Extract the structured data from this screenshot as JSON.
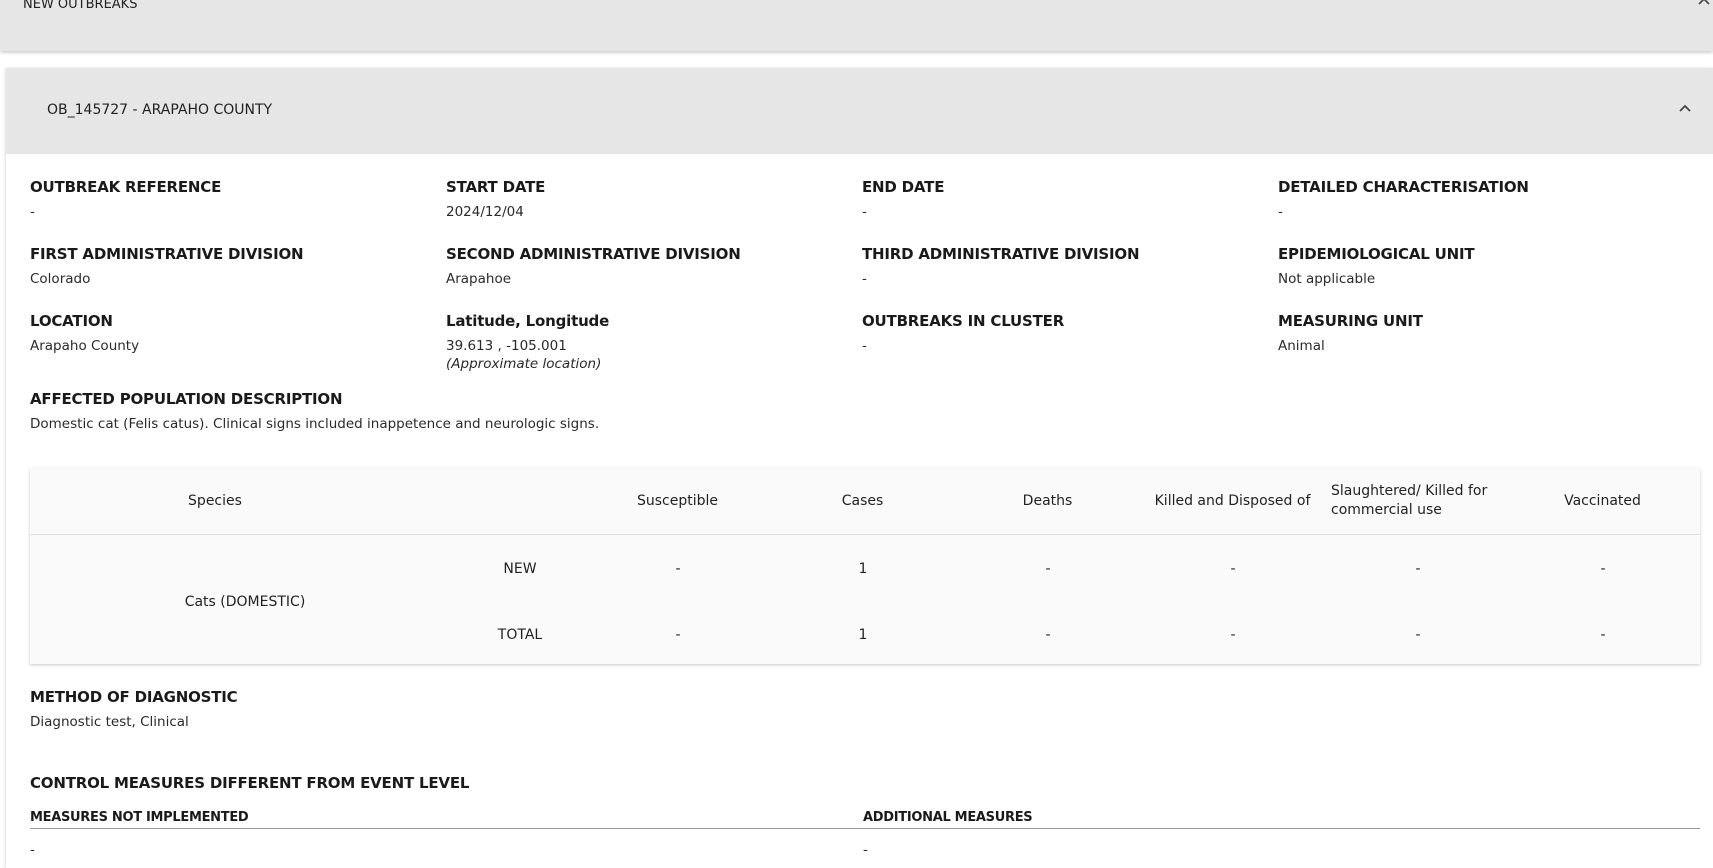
{
  "top_panel": {
    "title": "NEW OUTBREAKS"
  },
  "outbreak": {
    "title": "OB_145727 - ARAPAHO COUNTY",
    "fields": {
      "outbreak_reference": {
        "label": "OUTBREAK REFERENCE",
        "value": "-"
      },
      "start_date": {
        "label": "START DATE",
        "value": "2024/12/04"
      },
      "end_date": {
        "label": "END DATE",
        "value": "-"
      },
      "detailed_characterisation": {
        "label": "DETAILED CHARACTERISATION",
        "value": "-"
      },
      "first_admin": {
        "label": "FIRST ADMINISTRATIVE DIVISION",
        "value": "Colorado"
      },
      "second_admin": {
        "label": "SECOND ADMINISTRATIVE DIVISION",
        "value": "Arapahoe"
      },
      "third_admin": {
        "label": "THIRD ADMINISTRATIVE DIVISION",
        "value": "-"
      },
      "epi_unit": {
        "label": "EPIDEMIOLOGICAL UNIT",
        "value": "Not applicable"
      },
      "location": {
        "label": "LOCATION",
        "value": "Arapaho County"
      },
      "latlon": {
        "label": "Latitude, Longitude",
        "value": "39.613 , -105.001",
        "note": "(Approximate location)"
      },
      "outbreaks_in_cluster": {
        "label": "OUTBREAKS IN CLUSTER",
        "value": "-"
      },
      "measuring_unit": {
        "label": "MEASURING UNIT",
        "value": "Animal"
      },
      "affected_population": {
        "label": "AFFECTED POPULATION DESCRIPTION",
        "value": "Domestic cat (Felis catus). Clinical signs included inappetence and neurologic signs."
      }
    },
    "table": {
      "headers": {
        "species": "Species",
        "susceptible": "Susceptible",
        "cases": "Cases",
        "deaths": "Deaths",
        "killed": "Killed and Disposed of",
        "slaughtered": "Slaughtered/ Killed for commercial use",
        "vaccinated": "Vaccinated"
      },
      "species_name": "Cats (DOMESTIC)",
      "rows": [
        {
          "type": "NEW",
          "susceptible": "-",
          "cases": "1",
          "deaths": "-",
          "killed": "-",
          "slaughtered": "-",
          "vaccinated": "-"
        },
        {
          "type": "TOTAL",
          "susceptible": "-",
          "cases": "1",
          "deaths": "-",
          "killed": "-",
          "slaughtered": "-",
          "vaccinated": "-"
        }
      ]
    },
    "method_of_diagnostic": {
      "label": "METHOD OF DIAGNOSTIC",
      "value": "Diagnostic test, Clinical"
    },
    "control_measures": {
      "label": "CONTROL MEASURES DIFFERENT FROM EVENT LEVEL",
      "not_implemented": {
        "label": "MEASURES NOT IMPLEMENTED",
        "value": "-"
      },
      "additional": {
        "label": "ADDITIONAL MEASURES",
        "value": "-"
      }
    }
  }
}
